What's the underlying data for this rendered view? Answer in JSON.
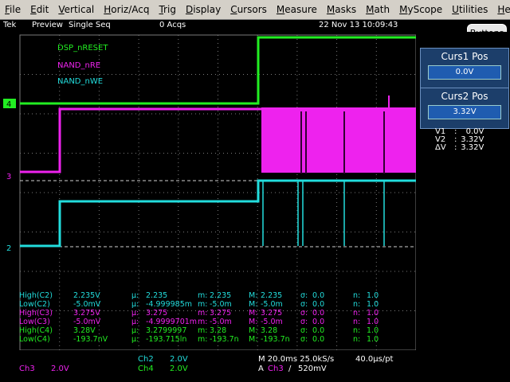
{
  "menubar": {
    "items": [
      {
        "label": "File",
        "key": "F",
        "rest": "ile"
      },
      {
        "label": "Edit",
        "key": "E",
        "rest": "dit"
      },
      {
        "label": "Vertical",
        "key": "V",
        "rest": "ertical"
      },
      {
        "label": "Horiz/Acq",
        "key": "H",
        "rest": "oriz/Acq"
      },
      {
        "label": "Trig",
        "key": "T",
        "rest": "rig"
      },
      {
        "label": "Display",
        "key": "D",
        "rest": "isplay"
      },
      {
        "label": "Cursors",
        "key": "C",
        "rest": "ursors"
      },
      {
        "label": "Measure",
        "key": "M",
        "rest": "easure"
      },
      {
        "label": "Masks",
        "key": "M",
        "rest": "asks"
      },
      {
        "label": "Math",
        "key": "M",
        "rest": "ath"
      },
      {
        "label": "MyScope",
        "key": "M",
        "rest": "yScope"
      },
      {
        "label": "Utilities",
        "key": "U",
        "rest": "tilities"
      },
      {
        "label": "Help",
        "key": "H",
        "rest": "elp"
      }
    ]
  },
  "status": {
    "brand": "Tek",
    "mode": "Preview",
    "seq": "Single Seq",
    "acqs": "0 Acqs",
    "datetime": "22 Nov 13 10:09:43"
  },
  "buttons_label": "Buttons",
  "cursors": {
    "curs1_title": "Curs1 Pos",
    "curs1_value": "0.0V",
    "curs2_title": "Curs2 Pos",
    "curs2_value": "3.32V",
    "readouts": [
      {
        "label": "V1",
        "sep": ":",
        "value": "0.0V"
      },
      {
        "label": "V2",
        "sep": ":",
        "value": "3.32V"
      },
      {
        "label": "ΔV",
        "sep": ":",
        "value": "3.32V"
      }
    ]
  },
  "channels": {
    "labels": [
      {
        "text": "DSP_nRESET",
        "color": "#22ee22"
      },
      {
        "text": "NAND_nRE",
        "color": "#ee22ee"
      },
      {
        "text": "NAND_nWE",
        "color": "#22dddd"
      }
    ],
    "markers": [
      {
        "text": "4",
        "color": "#22ee22"
      },
      {
        "text": "3",
        "color": "#ee22ee"
      },
      {
        "text": "2",
        "color": "#22dddd"
      }
    ]
  },
  "measurements": [
    {
      "name": "High(C2)",
      "value": "2.235V",
      "mu": "2.235",
      "m": "2.235",
      "M": "2.235",
      "sigma": "0.0",
      "n": "1.0",
      "color": "#22dddd"
    },
    {
      "name": "Low(C2)",
      "value": "-5.0mV",
      "mu": "-4.999985m",
      "m": "-5.0m",
      "M": "-5.0m",
      "sigma": "0.0",
      "n": "1.0",
      "color": "#22dddd"
    },
    {
      "name": "High(C3)",
      "value": "3.275V",
      "mu": "3.275",
      "m": "3.275",
      "M": "3.275",
      "sigma": "0.0",
      "n": "1.0",
      "color": "#ee22ee"
    },
    {
      "name": "Low(C3)",
      "value": "-5.0mV",
      "mu": "-4.9999701m",
      "m": "-5.0m",
      "M": "-5.0m",
      "sigma": "0.0",
      "n": "1.0",
      "color": "#ee22ee"
    },
    {
      "name": "High(C4)",
      "value": "3.28V",
      "mu": "3.2799997",
      "m": "3.28",
      "M": "3.28",
      "sigma": "0.0",
      "n": "1.0",
      "color": "#22ee22"
    },
    {
      "name": "Low(C4)",
      "value": "-193.7nV",
      "mu": "-193.715ln",
      "m": "-193.7n",
      "M": "-193.7n",
      "sigma": "0.0",
      "n": "1.0",
      "color": "#22ee22"
    }
  ],
  "stat_labels": {
    "mu": "µ:",
    "m": "m:",
    "M": "M:",
    "sigma": "σ:",
    "n": "n:"
  },
  "bottom": {
    "ch3": "Ch3",
    "ch3_scale": "2.0V",
    "ch2": "Ch2",
    "ch2_scale": "2.0V",
    "ch4": "Ch4",
    "ch4_scale": "2.0V",
    "timebase": "M 20.0ms 25.0kS/s",
    "resolution": "40.0µs/pt",
    "trig_a": "A",
    "trig_ch": "Ch3",
    "trig_slope": "/",
    "trig_level": "520mV"
  },
  "colors": {
    "ch2": "#22dddd",
    "ch3": "#ee22ee",
    "ch4": "#22ee22",
    "grid": "#7a7a7a"
  }
}
